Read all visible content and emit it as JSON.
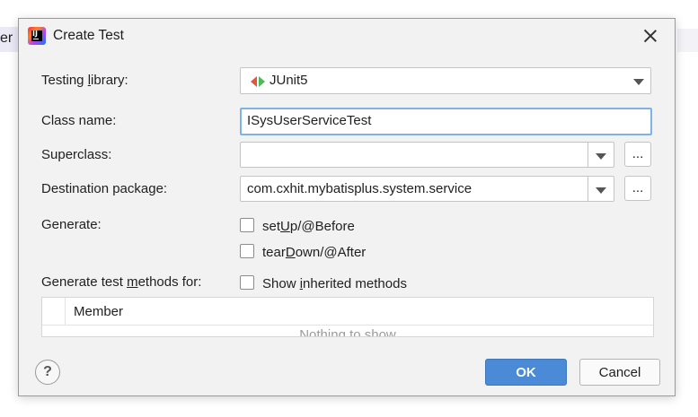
{
  "background": {
    "editor_fragment": "er"
  },
  "dialog": {
    "title": "Create Test",
    "app_icon": "intellij-idea-icon",
    "close_icon": "close-icon"
  },
  "form": {
    "testing_library": {
      "label_pre": "Testing ",
      "label_mnemonic": "l",
      "label_post": "ibrary:",
      "value": "JUnit5",
      "icon": "junit5-icon"
    },
    "class_name": {
      "label": "Class name:",
      "value": "ISysUserServiceTest"
    },
    "superclass": {
      "label": "Superclass:",
      "value": "",
      "browse_label": "..."
    },
    "destination_package": {
      "label": "Destination package:",
      "value": "com.cxhit.mybatisplus.system.service",
      "browse_label": "..."
    },
    "generate": {
      "label": "Generate:",
      "options": [
        {
          "pre": "set",
          "mnemonic": "U",
          "post": "p/@Before",
          "checked": false
        },
        {
          "pre": "tear",
          "mnemonic": "D",
          "post": "own/@After",
          "checked": false
        }
      ]
    },
    "generate_methods": {
      "label_pre": "Generate test ",
      "label_mnemonic": "m",
      "label_post": "ethods for:",
      "show_inherited": {
        "pre": "Show ",
        "mnemonic": "i",
        "post": "nherited methods",
        "checked": false
      }
    },
    "table": {
      "column": "Member",
      "empty_text": "Nothing to show"
    }
  },
  "footer": {
    "help_label": "?",
    "ok_label": "OK",
    "cancel_label": "Cancel"
  },
  "colors": {
    "accent": "#4a8ad6",
    "focus_border": "#7fb2e5",
    "dialog_bg": "#f2f2f2"
  }
}
